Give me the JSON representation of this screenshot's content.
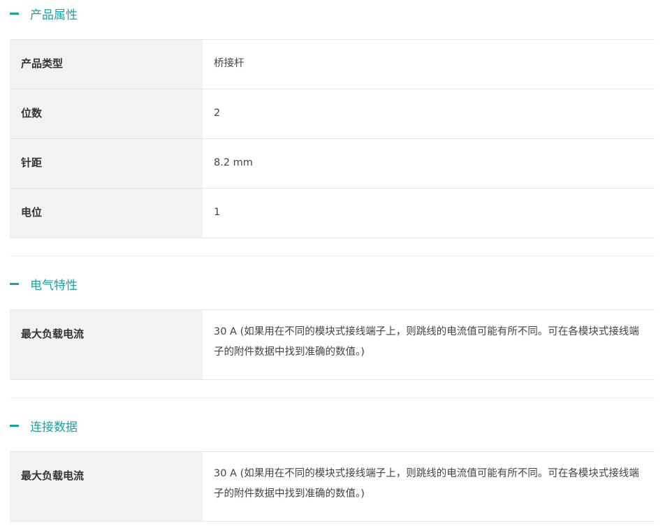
{
  "sections": [
    {
      "title": "产品属性",
      "rows": [
        {
          "label": "产品类型",
          "value": "桥接杆"
        },
        {
          "label": "位数",
          "value": "2"
        },
        {
          "label": "针距",
          "value": "8.2 mm"
        },
        {
          "label": "电位",
          "value": "1"
        }
      ]
    },
    {
      "title": "电气特性",
      "rows": [
        {
          "label": "最大负载电流",
          "value": "30 A (如果用在不同的模块式接线端子上，则跳线的电流值可能有所不同。可在各模块式接线端子的附件数据中找到准确的数值。)"
        }
      ]
    },
    {
      "title": "连接数据",
      "rows": [
        {
          "label": "最大负载电流",
          "value": "30 A (如果用在不同的模块式接线端子上，则跳线的电流值可能有所不同。可在各模块式接线端子的附件数据中找到准确的数值。)"
        }
      ]
    }
  ],
  "colors": {
    "accent": "#1aa3a3",
    "label_bg": "#f2f2f2",
    "border": "#e6e6e6"
  }
}
